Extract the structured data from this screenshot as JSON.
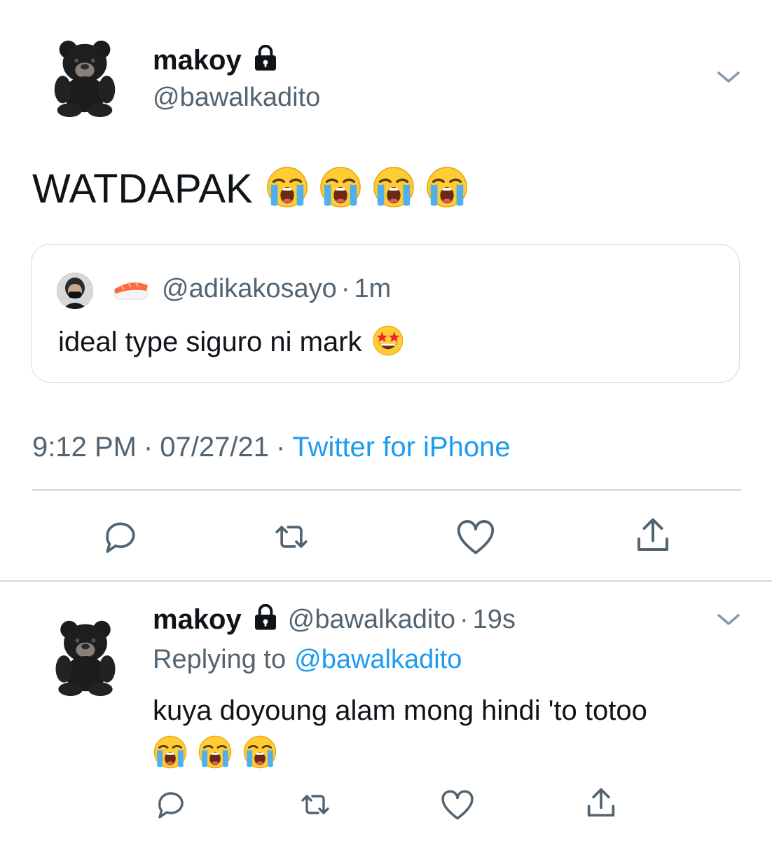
{
  "main_tweet": {
    "author_name": "makoy",
    "author_handle": "@bawalkadito",
    "locked": true,
    "text": "WATDAPAK",
    "emoji_count": 4,
    "emoji": "loudly-crying-face",
    "quoted": {
      "handle": "@adikakosayo",
      "time_sep": "·",
      "time": "1m",
      "name_emoji": "sushi",
      "text": "ideal type siguro ni mark",
      "trailing_emoji": "star-struck"
    },
    "meta": {
      "time": "9:12 PM",
      "sep1": "·",
      "date": "07/27/21",
      "sep2": "·",
      "source": "Twitter for iPhone"
    }
  },
  "reply_tweet": {
    "author_name": "makoy",
    "locked": true,
    "author_handle": "@bawalkadito",
    "time_sep": "·",
    "time": "19s",
    "replying_prefix": "Replying to",
    "replying_handle": "@bawalkadito",
    "text": "kuya doyoung alam mong hindi 'to totoo",
    "emoji_count": 3,
    "emoji": "loudly-crying-face"
  },
  "icons": {
    "reply": "reply-icon",
    "retweet": "retweet-icon",
    "like": "heart-icon",
    "share": "share-icon",
    "more": "chevron-down-icon",
    "lock": "lock-icon"
  },
  "colors": {
    "link": "#1d9bf0",
    "muted": "#536471",
    "border": "#cfd9de"
  }
}
